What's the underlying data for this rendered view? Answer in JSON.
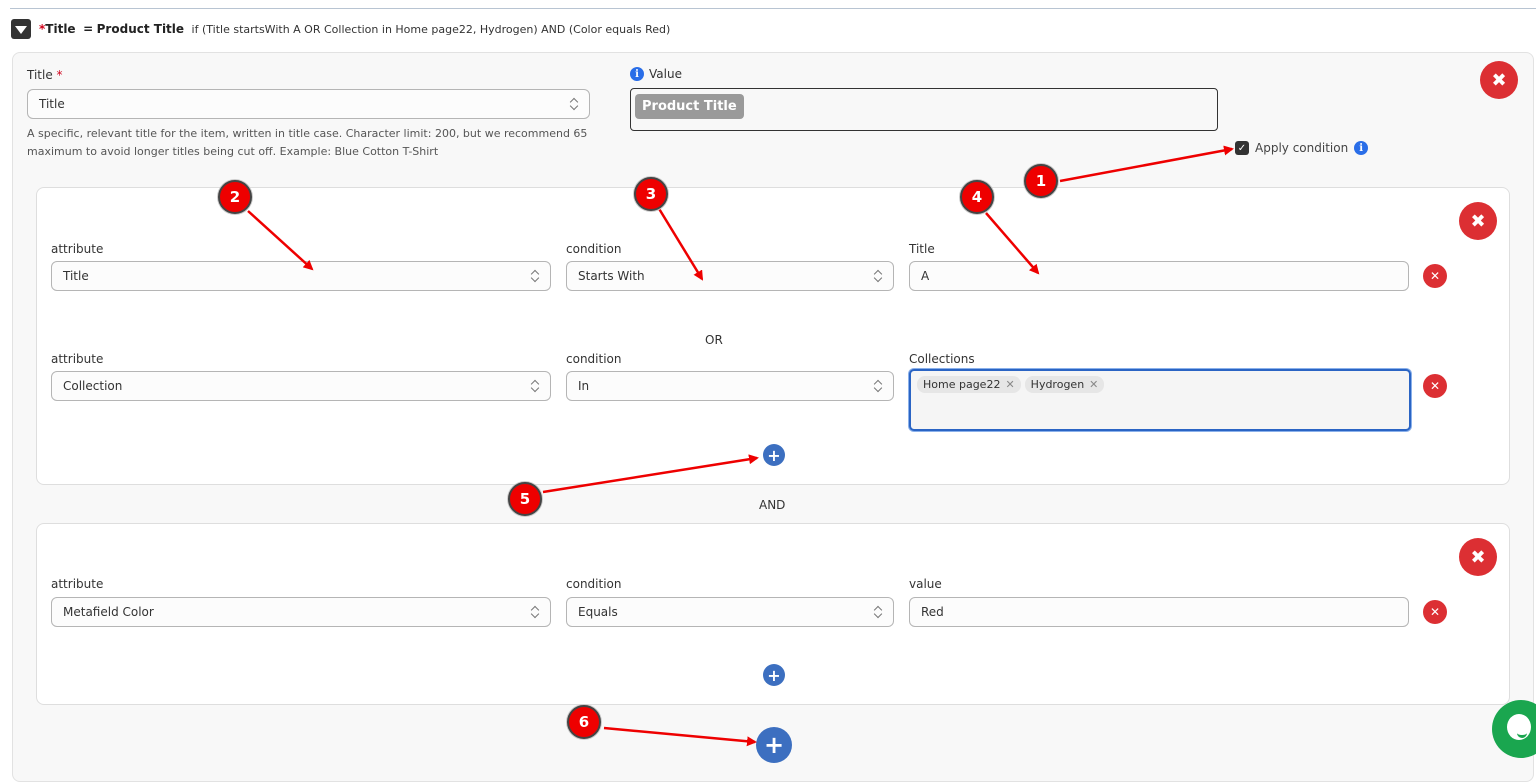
{
  "header": {
    "required_marker": "*",
    "field_name": "Title",
    "equals": "=",
    "value": "Product Title",
    "condition_summary": "if (Title startsWith A OR Collection in Home page22, Hydrogen) AND (Color equals Red)"
  },
  "field": {
    "label": "Title",
    "required_marker": "*",
    "selected": "Title",
    "help_text": "A specific, relevant title for the item, written in title case. Character limit: 200, but we recommend 65 maximum to avoid longer titles being cut off. Example: Blue Cotton T-Shirt"
  },
  "value": {
    "info_icon": "i",
    "label": "Value",
    "chip": "Product Title"
  },
  "apply_condition": {
    "label": "Apply condition",
    "checked": true,
    "check_glyph": "✓",
    "info_icon": "i"
  },
  "close_glyph": "✖",
  "remove_glyph": "✕",
  "add_glyph": "+",
  "groups": [
    {
      "conditions": [
        {
          "attribute_label": "attribute",
          "attribute": "Title",
          "condition_label": "condition",
          "condition": "Starts With",
          "value_label": "Title",
          "value": "A"
        },
        {
          "attribute_label": "attribute",
          "attribute": "Collection",
          "condition_label": "condition",
          "condition": "In",
          "value_label": "Collections",
          "tags": [
            "Home page22",
            "Hydrogen"
          ]
        }
      ],
      "joiner": "OR"
    },
    {
      "conditions": [
        {
          "attribute_label": "attribute",
          "attribute": "Metafield Color",
          "condition_label": "condition",
          "condition": "Equals",
          "value_label": "value",
          "value": "Red"
        }
      ]
    }
  ],
  "group_joiner": "AND",
  "annotations": [
    "1",
    "2",
    "3",
    "4",
    "5",
    "6"
  ],
  "colors": {
    "danger": "#dc2f33",
    "primary": "#3c6fc0",
    "info": "#2a6ee8",
    "annotation": "#ee0000",
    "chat": "#1aa64f"
  }
}
